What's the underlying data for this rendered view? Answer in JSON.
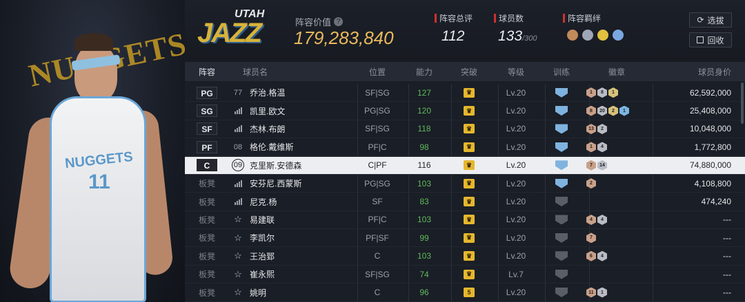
{
  "team": {
    "logo_text": "UTAH",
    "logo_sub": "JAZZ",
    "value_label": "阵容价值",
    "value": "179,283,840"
  },
  "stats": {
    "rating_label": "阵容总评",
    "rating": "112",
    "count_label": "球员数",
    "count": "133",
    "count_max": "/300",
    "bond_label": "阵容羁绊"
  },
  "buttons": {
    "select": "选拔",
    "recycle": "回收"
  },
  "headers": {
    "pos": "阵容",
    "name": "球员名",
    "position": "位置",
    "ability": "能力",
    "breakthrough": "突破",
    "level": "等级",
    "training": "训练",
    "badges": "徽章",
    "value": "球员身价"
  },
  "portrait": {
    "jersey_team": "NUGGETS",
    "jersey_number": "11",
    "wall_text": "NUGGETS"
  },
  "rows": [
    {
      "pos": "PG",
      "num": "77",
      "name": "乔治.格温",
      "position": "SF|SG",
      "ability": "127",
      "level": "Lv.20",
      "price": "62,592,000",
      "badges": [
        "1",
        "8",
        "1"
      ],
      "brk": "",
      "train": "blue"
    },
    {
      "pos": "SG",
      "num": "",
      "name": "凯里.欧文",
      "position": "PG|SG",
      "ability": "120",
      "level": "Lv.20",
      "price": "25,408,000",
      "badges": [
        "8",
        "20",
        "2",
        "1"
      ],
      "brk": "",
      "train": "blue"
    },
    {
      "pos": "SF",
      "num": "",
      "name": "杰林.布朗",
      "position": "SF|SG",
      "ability": "118",
      "level": "Lv.20",
      "price": "10,048,000",
      "badges": [
        "13",
        "2"
      ],
      "brk": "",
      "train": "blue"
    },
    {
      "pos": "PF",
      "num": "08",
      "name": "格伦.戴维斯",
      "position": "PF|C",
      "ability": "98",
      "level": "Lv.20",
      "price": "1,772,800",
      "badges": [
        "1",
        "4"
      ],
      "brk": "",
      "train": "blue"
    },
    {
      "pos": "C",
      "num": "09",
      "name": "克里斯.安德森",
      "position": "C|PF",
      "ability": "116",
      "level": "Lv.20",
      "price": "74,880,000",
      "badges": [
        "7",
        "14"
      ],
      "brk": "",
      "train": "blue"
    },
    {
      "pos": "板凳",
      "num": "",
      "name": "安芬尼.西蒙斯",
      "position": "PG|SG",
      "ability": "103",
      "level": "Lv.20",
      "price": "4,108,800",
      "badges": [
        "2"
      ],
      "brk": "",
      "train": "blue"
    },
    {
      "pos": "板凳",
      "num": "",
      "name": "尼克.杨",
      "position": "SF",
      "ability": "83",
      "level": "Lv.20",
      "price": "474,240",
      "badges": [],
      "brk": "",
      "train": "gray"
    },
    {
      "pos": "板凳",
      "num": "",
      "name": "易建联",
      "position": "PF|C",
      "ability": "103",
      "level": "Lv.20",
      "price": "---",
      "badges": [
        "4",
        "4"
      ],
      "brk": "",
      "train": "gray"
    },
    {
      "pos": "板凳",
      "num": "",
      "name": "李凯尔",
      "position": "PF|SF",
      "ability": "99",
      "level": "Lv.20",
      "price": "---",
      "badges": [
        "7"
      ],
      "brk": "",
      "train": "gray"
    },
    {
      "pos": "板凳",
      "num": "",
      "name": "王治郅",
      "position": "C",
      "ability": "103",
      "level": "Lv.20",
      "price": "---",
      "badges": [
        "6",
        "4"
      ],
      "brk": "",
      "train": "gray"
    },
    {
      "pos": "板凳",
      "num": "",
      "name": "崔永熙",
      "position": "SF|SG",
      "ability": "74",
      "level": "Lv.7",
      "price": "---",
      "badges": [],
      "brk": "",
      "train": "gray"
    },
    {
      "pos": "板凳",
      "num": "",
      "name": "姚明",
      "position": "C",
      "ability": "96",
      "level": "Lv.20",
      "price": "---",
      "badges": [
        "11",
        "1"
      ],
      "brk": "5",
      "train": "gray"
    }
  ]
}
